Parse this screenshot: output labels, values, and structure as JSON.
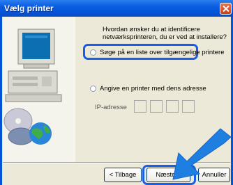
{
  "window": {
    "title": "Vælg printer"
  },
  "prompt": "Hvordan ønsker du at identificere netværksprinteren, du er ved at installere?",
  "options": [
    {
      "label": "Søge på en liste over tilgængelige printere",
      "selected": false
    },
    {
      "label": "Angive en printer med dens adresse",
      "selected": false
    }
  ],
  "ip": {
    "label": "IP-adresse"
  },
  "buttons": {
    "back_label": "< Tilbage",
    "next_label": "Næste >",
    "cancel_label": "Annuller"
  },
  "colors": {
    "titlebar": "#0a5ce0",
    "highlight": "#1a5ee8",
    "arrow": "#1f7fe0"
  },
  "icons": [
    "close-icon",
    "computer-illustration",
    "cd-disc-icon",
    "globe-icon",
    "pointer-arrow"
  ]
}
